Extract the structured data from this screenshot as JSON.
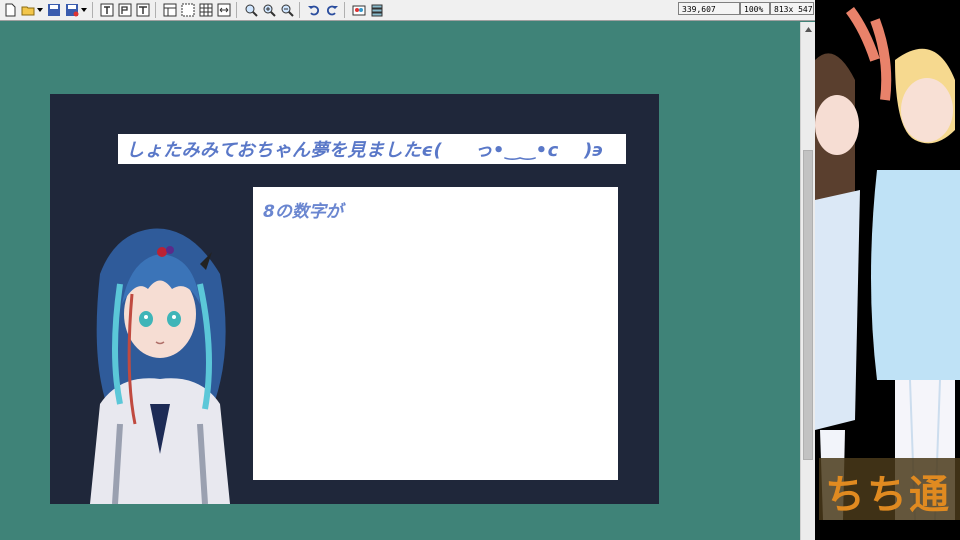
{
  "toolbar": {
    "coords": "339,607",
    "zoom": "100%",
    "size": "813x 547"
  },
  "slide": {
    "title": "しょたみみておちゃん夢を見ましたϵ( 　 っ•‿‿•c　 )϶",
    "content": "8の数字が"
  },
  "preview": {
    "banner_text": "ちち通"
  },
  "colors": {
    "canvas_bg": "#3f8378",
    "slide_bg": "#1f273a",
    "title_text": "#5a78c8",
    "content_text": "#6a86d0",
    "banner_text": "#e08a20"
  }
}
